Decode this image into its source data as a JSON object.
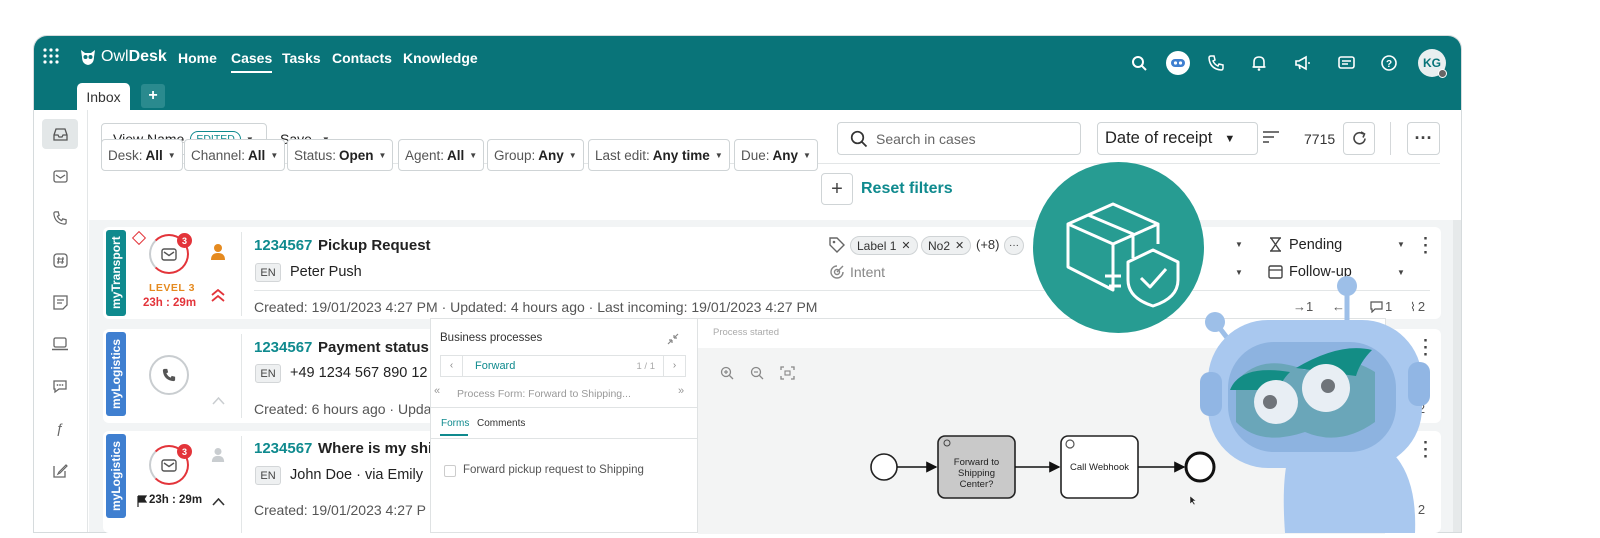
{
  "app": {
    "name_prefix": "Owl",
    "name_bold": "Desk"
  },
  "nav": {
    "home": "Home",
    "cases": "Cases",
    "tasks": "Tasks",
    "contacts": "Contacts",
    "knowledge": "Knowledge"
  },
  "user": {
    "initials": "KG"
  },
  "tabs": {
    "inbox": "Inbox",
    "add": "+"
  },
  "toolbar": {
    "view_name": "View Name",
    "edited_badge": "EDITED",
    "save": "Save",
    "search_placeholder": "Search in cases",
    "sort_field": "Date of receipt",
    "count": "7715"
  },
  "filters": [
    {
      "label": "Desk:",
      "value": "All"
    },
    {
      "label": "Channel:",
      "value": "All"
    },
    {
      "label": "Status:",
      "value": "Open"
    },
    {
      "label": "Agent:",
      "value": "All"
    },
    {
      "label": "Group:",
      "value": "Any"
    },
    {
      "label": "Last edit:",
      "value": "Any time"
    },
    {
      "label": "Due:",
      "value": "Any"
    }
  ],
  "reset_filters": "Reset filters",
  "cases": [
    {
      "desk": "myTransport",
      "badge_count": "3",
      "level": "LEVEL 3",
      "timer": "23h : 29m",
      "id": "1234567",
      "title": "Pickup Request",
      "lang": "EN",
      "contact": "Peter Push",
      "labels": [
        "Label 1",
        "No2"
      ],
      "labels_more": "(+8)",
      "intent": "Intent",
      "status": "Pending",
      "follow_up": "Follow-up",
      "meta": "Created: 19/01/2023 4:27 PM · Updated: 4 hours ago · Last incoming: 19/01/2023 4:27 PM",
      "stat_out": "1",
      "stat_comments": "1",
      "stat_attachments": "2"
    },
    {
      "desk": "myLogistics",
      "id": "1234567",
      "title": "Payment status",
      "lang": "EN",
      "contact": "+49 1234 567 890 12",
      "meta": "Created: 6 hours ago · Upda",
      "stat_attachments": "2"
    },
    {
      "desk": "myLogistics",
      "badge_count": "3",
      "timer": "23h : 29m",
      "id": "1234567",
      "title": "Where is my shi",
      "lang": "EN",
      "contact": "John Doe · via Emily",
      "meta": "Created: 19/01/2023 4:27 P",
      "stat_attachments": "2"
    }
  ],
  "business_processes": {
    "title": "Business processes",
    "process": "Forward",
    "pager": "1 / 1",
    "form_label": "Process Form: Forward to Shipping...",
    "tab_forms": "Forms",
    "tab_comments": "Comments",
    "checkbox_label": "Forward pickup request to Shipping"
  },
  "process_canvas": {
    "status": "Process started",
    "task1": [
      "Forward to",
      "Shipping",
      "Center?"
    ],
    "task2": "Call Webhook"
  },
  "colors": {
    "brand": "#097479",
    "accent": "#0f8a8e",
    "danger": "#e3343a",
    "desk_transport": "#0f8a8e",
    "desk_logistics": "#3f7fd0",
    "robot": "#a9c8ef"
  }
}
